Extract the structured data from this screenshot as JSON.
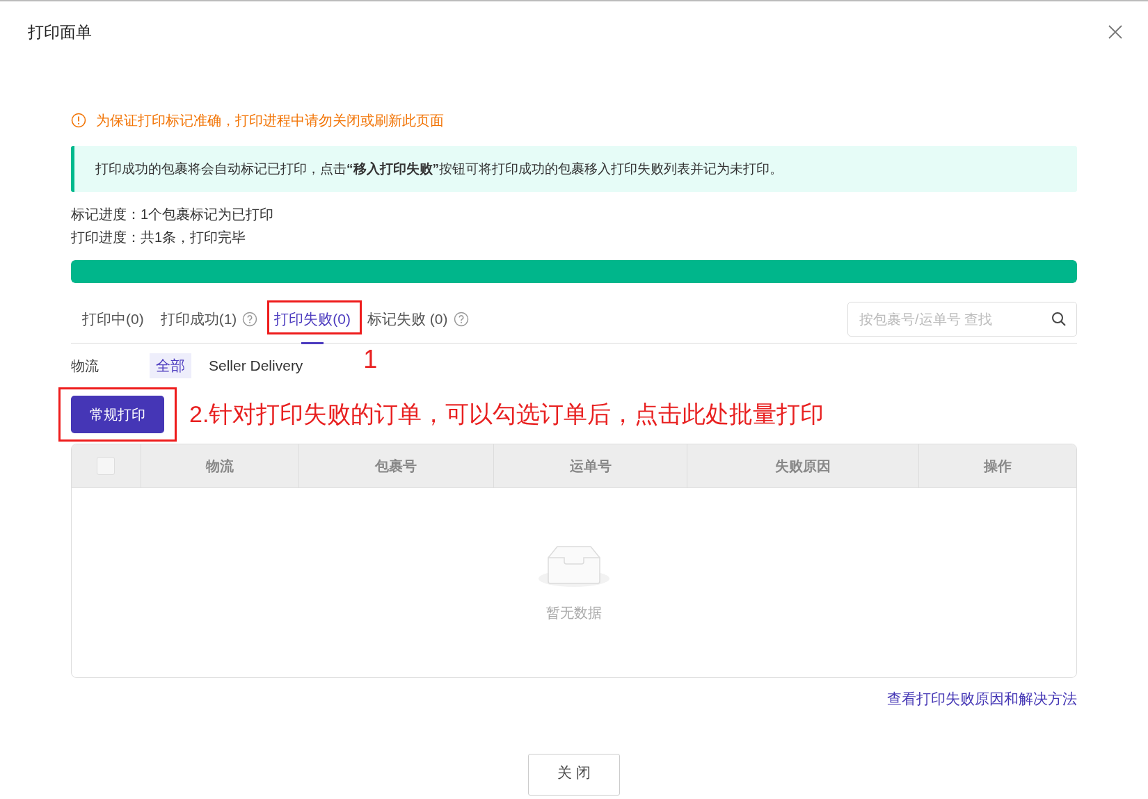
{
  "dialog": {
    "title": "打印面单"
  },
  "warning": "为保证打印标记准确，打印进程中请勿关闭或刷新此页面",
  "info": "打印成功的包裹将会自动标记已打印，点击**“移入打印失败”**按钮可将打印成功的包裹移入打印失败列表并记为未打印。",
  "progress_lines": [
    "标记进度：1个包裹标记为已打印",
    "打印进度：共1条，打印完毕"
  ],
  "progress": {
    "level": 1
  },
  "tabs": [
    {
      "label": "打印中(0)",
      "selected": false,
      "help": false
    },
    {
      "label": "打印成功(1)",
      "selected": false,
      "help": true
    },
    {
      "label": "打印失败(0)",
      "selected": true,
      "help": false
    },
    {
      "label": "标记失败 (0)",
      "selected": false,
      "help": true
    }
  ],
  "search": {
    "placeholder": "按包裹号/运单号 查找"
  },
  "filter": {
    "label": "物流",
    "options": [
      {
        "label": "全部",
        "selected": true
      },
      {
        "label": "Seller Delivery",
        "selected": false
      }
    ]
  },
  "print_button": "常规打印",
  "annotations": [
    "1",
    "2.针对打印失败的订单，可以勾选订单后，点击此处批量打印"
  ],
  "table": {
    "select_all": {
      "checked": false
    },
    "columns": [
      "物流",
      "包裹号",
      "运单号",
      "失败原因",
      "操作"
    ],
    "empty_text": "暂无数据"
  },
  "help_link": "查看打印失败原因和解决方法",
  "close_button": "关 闭"
}
